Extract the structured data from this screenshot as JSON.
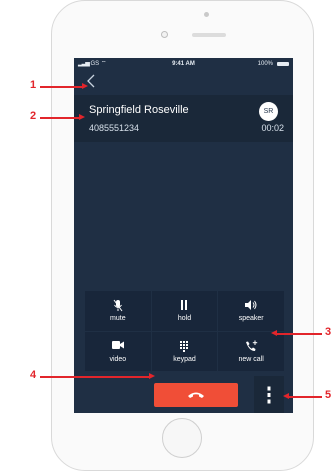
{
  "status_bar": {
    "carrier": "GS",
    "time": "9:41 AM",
    "battery": "100%"
  },
  "call": {
    "back_icon": "chevron-left-icon",
    "contact_name": "Springfield Roseville",
    "contact_number": "4085551234",
    "avatar_initials": "SR",
    "duration": "00:02"
  },
  "controls": [
    {
      "label": "mute",
      "icon": "microphone-muted-icon"
    },
    {
      "label": "hold",
      "icon": "pause-icon"
    },
    {
      "label": "speaker",
      "icon": "speaker-icon"
    },
    {
      "label": "video",
      "icon": "video-camera-icon"
    },
    {
      "label": "keypad",
      "icon": "keypad-icon"
    },
    {
      "label": "new call",
      "icon": "add-call-icon"
    }
  ],
  "end_call": {
    "icon": "end-call-icon"
  },
  "more": {
    "icon": "more-vertical-icon"
  },
  "callouts": [
    "1",
    "2",
    "3",
    "4",
    "5"
  ],
  "colors": {
    "screen_bg": "#1f2f44",
    "end_call": "#f04e37",
    "callout": "#e2252b"
  }
}
